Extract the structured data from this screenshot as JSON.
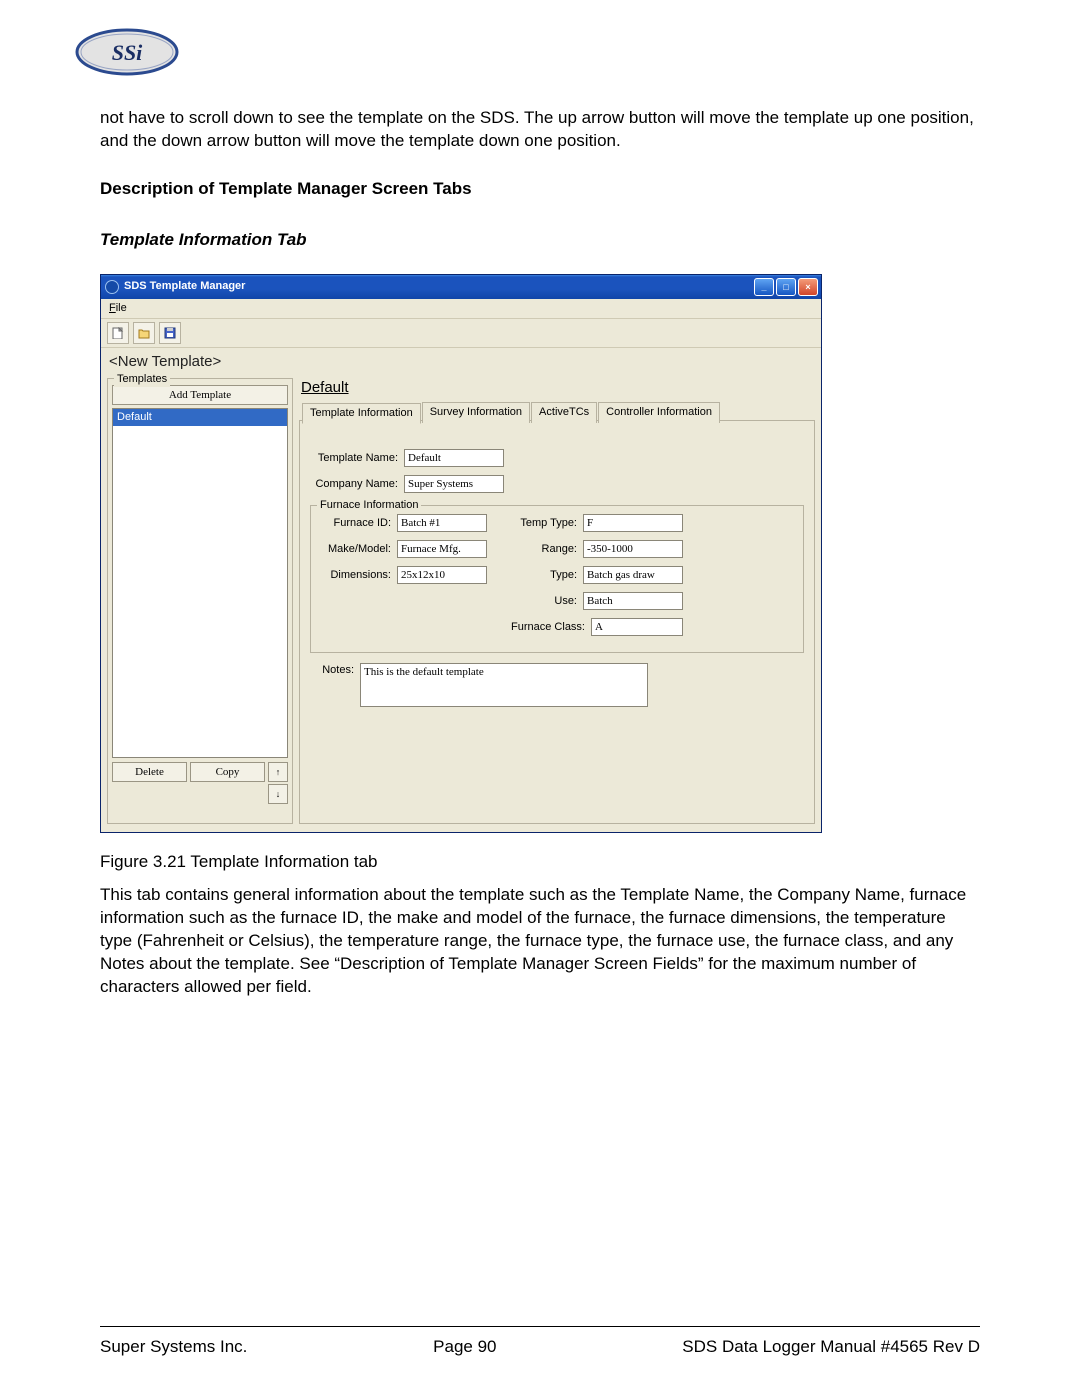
{
  "intro_para": "not have to scroll down to see the template on the SDS.  The up arrow button will move the template up one position, and the down arrow button will move the template down one position.",
  "heading_bold": "Description of Template Manager Screen Tabs",
  "heading_italic": "Template Information Tab",
  "window": {
    "title": "SDS Template Manager",
    "file_menu": "File",
    "template_name_header": "<New Template>",
    "templates_panel": {
      "title": "Templates",
      "add_button": "Add Template",
      "selected": "Default",
      "delete": "Delete",
      "copy": "Copy"
    },
    "right": {
      "title": "Default",
      "tabs": [
        "Template Information",
        "Survey Information",
        "ActiveTCs",
        "Controller Information"
      ],
      "active_tab": 0,
      "template_name_label": "Template Name:",
      "template_name_val": "Default",
      "company_name_label": "Company Name:",
      "company_name_val": "Super Systems",
      "furnace_info_title": "Furnace Information",
      "left_fields": {
        "furnace_id_lbl": "Furnace ID:",
        "furnace_id_val": "Batch #1",
        "make_model_lbl": "Make/Model:",
        "make_model_val": "Furnace Mfg.",
        "dimensions_lbl": "Dimensions:",
        "dimensions_val": "25x12x10"
      },
      "right_fields": {
        "temp_type_lbl": "Temp Type:",
        "temp_type_val": "F",
        "range_lbl": "Range:",
        "range_val": "-350-1000",
        "type_lbl": "Type:",
        "type_val": "Batch gas draw",
        "use_lbl": "Use:",
        "use_val": "Batch",
        "class_lbl": "Furnace Class:",
        "class_val": "A"
      },
      "notes_lbl": "Notes:",
      "notes_val": "This is the default template"
    }
  },
  "figure_caption": "Figure 3.21 Template Information tab",
  "body_para": "This tab contains general information about the template such as the Template Name, the Company Name, furnace information such as the furnace ID, the make and model of the furnace, the furnace dimensions, the temperature type (Fahrenheit or Celsius), the temperature range, the furnace type, the furnace use, the furnace class, and any Notes about the template.  See “Description of Template Manager Screen Fields” for the maximum number of characters allowed per field.",
  "footer": {
    "left": "Super Systems Inc.",
    "center": "Page 90",
    "right": "SDS Data Logger Manual #4565 Rev D"
  }
}
